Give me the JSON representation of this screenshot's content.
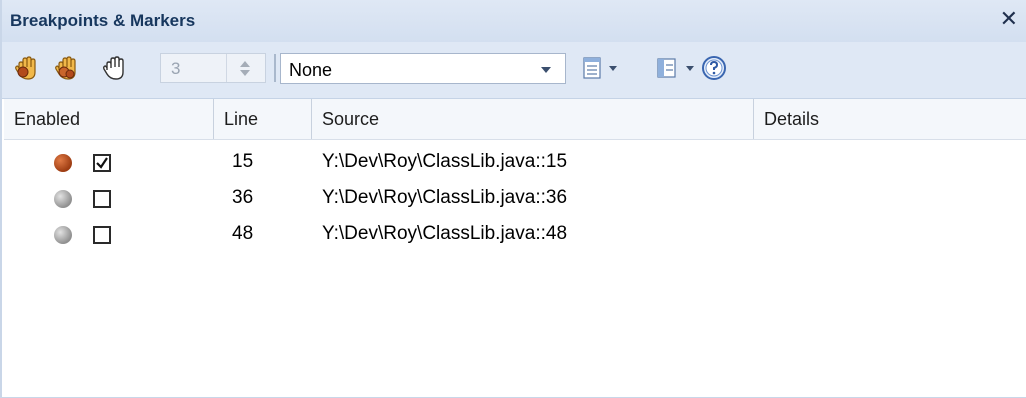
{
  "window": {
    "title": "Breakpoints & Markers",
    "close_label": "✕"
  },
  "toolbar": {
    "icons": [
      "set-breakpoint-hand-icon",
      "set-marker-hand-icon",
      "outline-hand-icon"
    ],
    "count_value": "3",
    "filter_selected": "None",
    "list_options_icon": "list-view-icon",
    "layout_icon": "layout-icon",
    "help_icon": "help-icon"
  },
  "table": {
    "columns": [
      "Enabled",
      "Line",
      "Source",
      "Details"
    ],
    "rows": [
      {
        "enabled": true,
        "active": true,
        "line": "15",
        "source": "Y:\\Dev\\Roy\\ClassLib.java::15",
        "details": ""
      },
      {
        "enabled": false,
        "active": false,
        "line": "36",
        "source": "Y:\\Dev\\Roy\\ClassLib.java::36",
        "details": ""
      },
      {
        "enabled": false,
        "active": false,
        "line": "48",
        "source": "Y:\\Dev\\Roy\\ClassLib.java::48",
        "details": ""
      }
    ]
  },
  "colors": {
    "title_text": "#17375e",
    "active_dot": "#b24a1c",
    "inactive_dot": "#a0a0a0",
    "toolbar_bg": "#dfe8f5"
  }
}
